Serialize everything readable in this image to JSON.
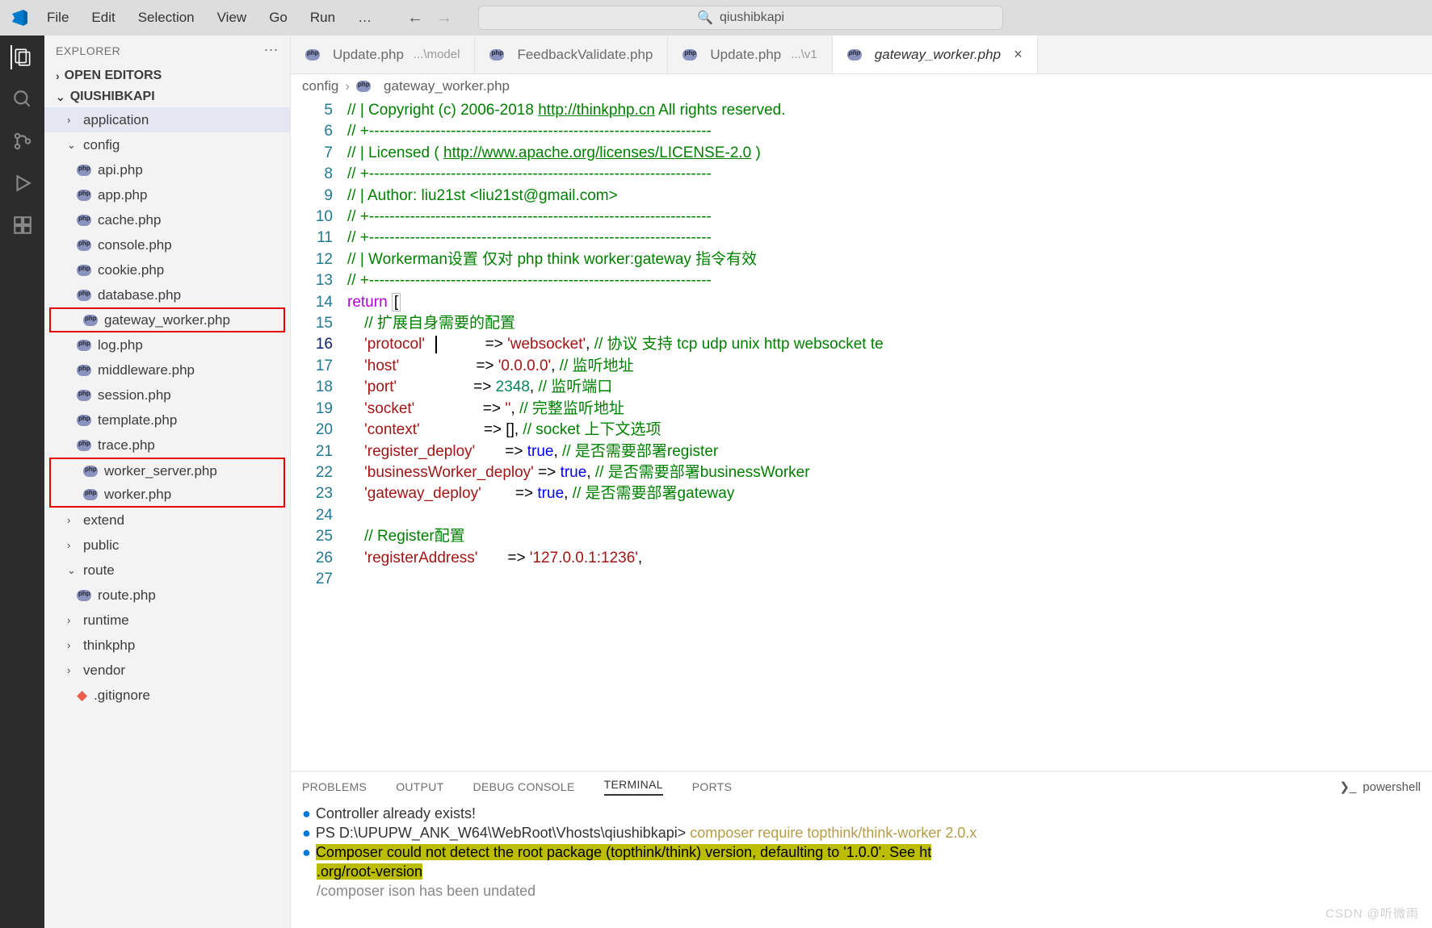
{
  "menu": [
    "File",
    "Edit",
    "Selection",
    "View",
    "Go",
    "Run",
    "…"
  ],
  "search": "qiushibkapi",
  "explorer": {
    "title": "EXPLORER",
    "openEditors": "OPEN EDITORS",
    "project": "QIUSHIBKAPI",
    "tree": [
      {
        "t": "folder",
        "label": "application",
        "indent": 1,
        "chev": ">"
      },
      {
        "t": "folder",
        "label": "config",
        "indent": 1,
        "chev": "v"
      },
      {
        "t": "php",
        "label": "api.php"
      },
      {
        "t": "php",
        "label": "app.php"
      },
      {
        "t": "php",
        "label": "cache.php"
      },
      {
        "t": "php",
        "label": "console.php"
      },
      {
        "t": "php",
        "label": "cookie.php"
      },
      {
        "t": "php",
        "label": "database.php"
      },
      {
        "t": "php",
        "label": "gateway_worker.php",
        "red": true
      },
      {
        "t": "php",
        "label": "log.php"
      },
      {
        "t": "php",
        "label": "middleware.php"
      },
      {
        "t": "php",
        "label": "session.php"
      },
      {
        "t": "php",
        "label": "template.php"
      },
      {
        "t": "php",
        "label": "trace.php"
      },
      {
        "t": "php",
        "label": "worker_server.php",
        "red": true,
        "redtop": true
      },
      {
        "t": "php",
        "label": "worker.php",
        "red": true,
        "redbot": true
      },
      {
        "t": "folder",
        "label": "extend",
        "indent": 1,
        "chev": ">"
      },
      {
        "t": "folder",
        "label": "public",
        "indent": 1,
        "chev": ">"
      },
      {
        "t": "folder",
        "label": "route",
        "indent": 1,
        "chev": "v"
      },
      {
        "t": "php",
        "label": "route.php"
      },
      {
        "t": "folder",
        "label": "runtime",
        "indent": 1,
        "chev": ">"
      },
      {
        "t": "folder",
        "label": "thinkphp",
        "indent": 1,
        "chev": ">"
      },
      {
        "t": "folder",
        "label": "vendor",
        "indent": 1,
        "chev": ">"
      },
      {
        "t": "file",
        "label": ".gitignore",
        "icon": "git"
      }
    ]
  },
  "tabs": [
    {
      "label": "Update.php",
      "dim": "...\\model"
    },
    {
      "label": "FeedbackValidate.php"
    },
    {
      "label": "Update.php",
      "dim": "...\\v1"
    },
    {
      "label": "gateway_worker.php",
      "active": true
    }
  ],
  "breadcrumb": [
    "config",
    "gateway_worker.php"
  ],
  "code": {
    "firstLine": 5,
    "activeLine": 16
  },
  "panel": {
    "tabs": [
      "PROBLEMS",
      "OUTPUT",
      "DEBUG CONSOLE",
      "TERMINAL",
      "PORTS"
    ],
    "active": "TERMINAL",
    "shell": "powershell",
    "terminal": {
      "l1": "Controller already exists!",
      "l2p": "PS D:\\UPUPW_ANK_W64\\WebRoot\\Vhosts\\qiushibkapi>",
      "l2c": "composer require topthink/think-worker 2.0.x",
      "l3": "Composer could not detect the root package (topthink/think) version, defaulting to '1.0.0'. See ht",
      "l3b": ".org/root-version",
      "l4": "/composer ison has been undated"
    }
  },
  "watermark": "CSDN @听微雨"
}
